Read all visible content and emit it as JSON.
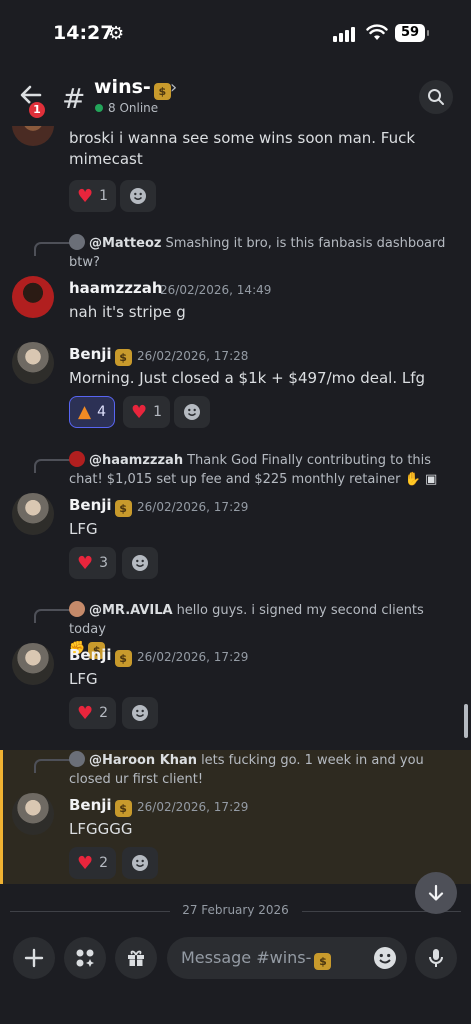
{
  "status_bar": {
    "time": "14:27",
    "battery": "59"
  },
  "header": {
    "back_badge": "1",
    "channel_name": "wins-",
    "online": "8 Online"
  },
  "messages": {
    "m0": {
      "text": "broski i wanna see some wins soon man. Fuck mimecast",
      "reactions": [
        {
          "emoji": "heart",
          "count": "1"
        }
      ]
    },
    "m1": {
      "reply_to_name": "@Matteoz",
      "reply_to_text": "Smashing it bro, is this fanbasis dashboard btw?",
      "author": "haamzzzah",
      "timestamp": "26/02/2026, 14:49",
      "text": "nah it's stripe g"
    },
    "m2": {
      "author": "Benji",
      "timestamp": "26/02/2026, 17:28",
      "text": "Morning. Just closed a $1k + $497/mo deal. Lfg",
      "reactions": [
        {
          "emoji": "fire",
          "count": "4",
          "active": true
        },
        {
          "emoji": "heart",
          "count": "1"
        }
      ]
    },
    "m3": {
      "reply_to_name": "@haamzzzah",
      "reply_to_text": "Thank God Finally contributing to this chat!  $1,015 set up fee and $225 monthly retainer",
      "author": "Benji",
      "timestamp": "26/02/2026, 17:29",
      "text": "LFG",
      "reactions": [
        {
          "emoji": "heart",
          "count": "3"
        }
      ]
    },
    "m4": {
      "reply_to_name": "@MR.AVILA",
      "reply_to_text": "hello guys. i signed my second clients today",
      "author": "Benji",
      "timestamp": "26/02/2026, 17:29",
      "text": "LFG",
      "reactions": [
        {
          "emoji": "heart",
          "count": "2"
        }
      ]
    },
    "m5": {
      "reply_to_name": "@Haroon Khan",
      "reply_to_text": "lets fucking go. 1 week in and you closed ur first client!",
      "author": "Benji",
      "timestamp": "26/02/2026, 17:29",
      "text": "LFGGGG",
      "reactions": [
        {
          "emoji": "heart",
          "count": "2"
        }
      ]
    }
  },
  "date_divider": "27 February 2026",
  "composer": {
    "placeholder": "Message #wins-"
  },
  "colors": {
    "accent": "#5865f2",
    "online": "#23a55a",
    "highlight": "#f0b232",
    "heart": "#e8253c"
  },
  "icons": [
    "gear-icon",
    "signal-icon",
    "wifi-icon",
    "back-arrow-icon",
    "hash-icon",
    "chevron-right-icon",
    "search-icon",
    "heart-icon",
    "fire-icon",
    "add-reaction-icon",
    "jump-down-icon",
    "plus-icon",
    "apps-icon",
    "gift-icon",
    "emoji-icon",
    "mic-icon",
    "money-bag-icon",
    "praying-hands-icon",
    "image-icon",
    "handshake-icon"
  ]
}
